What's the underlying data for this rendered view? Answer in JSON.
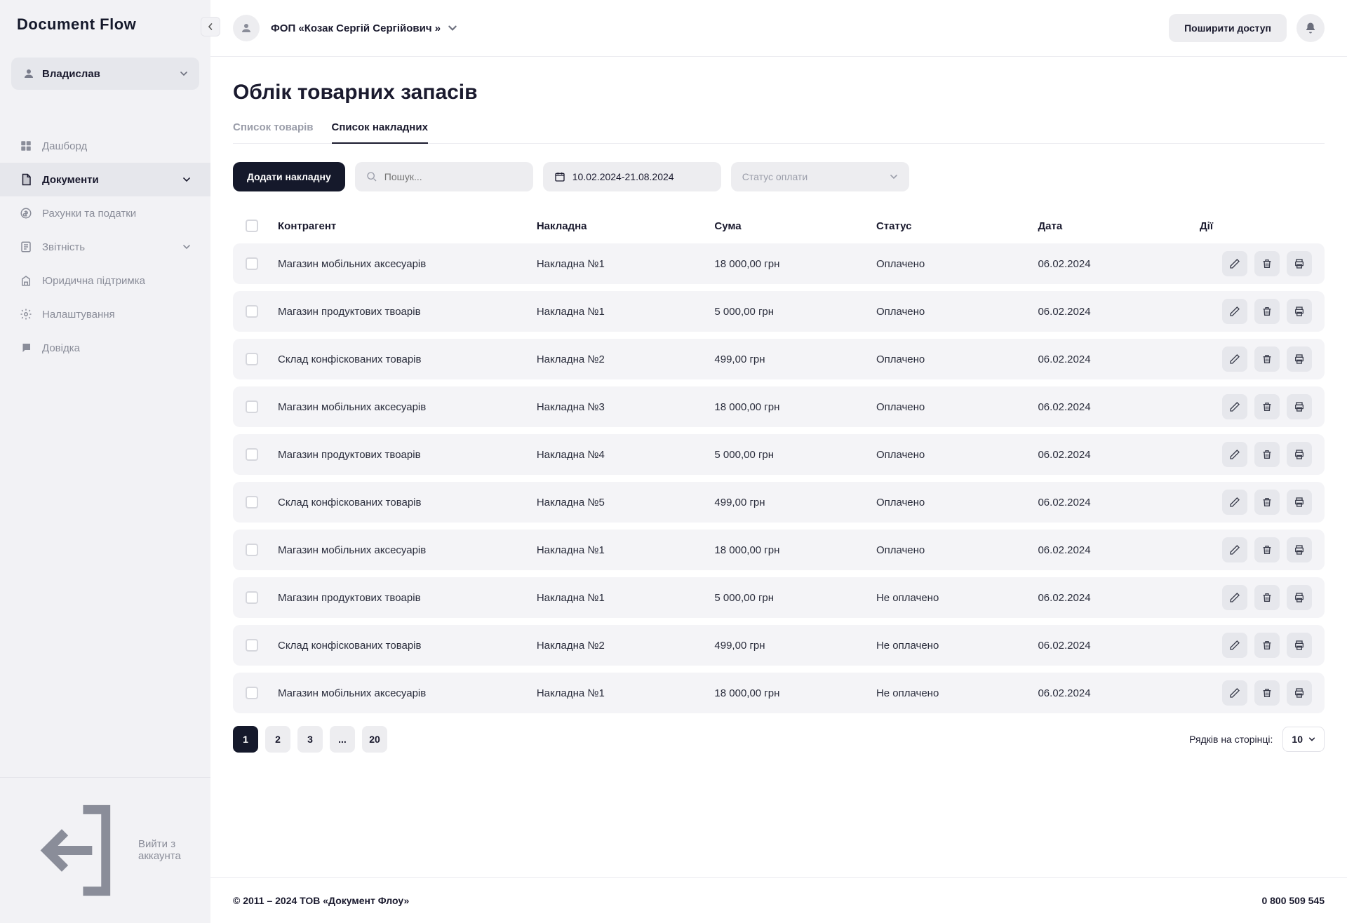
{
  "brand": "Document Flow",
  "user": {
    "name": "Владислав"
  },
  "sidebar": {
    "items": [
      {
        "label": "Дашборд",
        "icon": "dashboard",
        "expandable": false
      },
      {
        "label": "Документи",
        "icon": "documents",
        "expandable": true,
        "active": true
      },
      {
        "label": "Рахунки та податки",
        "icon": "accounts",
        "expandable": false
      },
      {
        "label": "Звітність",
        "icon": "reports",
        "expandable": true
      },
      {
        "label": "Юридична підтримка",
        "icon": "legal",
        "expandable": false
      },
      {
        "label": "Налаштування",
        "icon": "settings",
        "expandable": false
      },
      {
        "label": "Довідка",
        "icon": "help",
        "expandable": false
      }
    ],
    "logout_label": "Вийти з аккаунта"
  },
  "topbar": {
    "company": "ФОП «Козак Сергій Сергійович »",
    "share_label": "Поширити доступ"
  },
  "page": {
    "title": "Облік товарних запасів",
    "tabs": [
      {
        "label": "Список товарів",
        "active": false
      },
      {
        "label": "Список накладних",
        "active": true
      }
    ]
  },
  "toolbar": {
    "add_label": "Додати накладну",
    "search_placeholder": "Пошук...",
    "date_range": "10.02.2024-21.08.2024",
    "status_placeholder": "Статус оплати"
  },
  "table": {
    "headers": {
      "counterparty": "Контрагент",
      "invoice": "Накладна",
      "amount": "Сума",
      "status": "Статус",
      "date": "Дата",
      "actions": "Дії"
    },
    "rows": [
      {
        "counterparty": "Магазин мобільних аксесуарів",
        "invoice": "Накладна №1",
        "amount": "18 000,00 грн",
        "status": "Оплачено",
        "date": "06.02.2024"
      },
      {
        "counterparty": "Магазин продуктових твоарів",
        "invoice": "Накладна №1",
        "amount": "5 000,00 грн",
        "status": "Оплачено",
        "date": "06.02.2024"
      },
      {
        "counterparty": "Склад конфіскованих товарів",
        "invoice": "Накладна №2",
        "amount": "499,00 грн",
        "status": "Оплачено",
        "date": "06.02.2024"
      },
      {
        "counterparty": "Магазин мобільних аксесуарів",
        "invoice": "Накладна №3",
        "amount": "18 000,00 грн",
        "status": "Оплачено",
        "date": "06.02.2024"
      },
      {
        "counterparty": "Магазин продуктових твоарів",
        "invoice": "Накладна №4",
        "amount": "5 000,00 грн",
        "status": "Оплачено",
        "date": "06.02.2024"
      },
      {
        "counterparty": "Склад конфіскованих товарів",
        "invoice": "Накладна №5",
        "amount": "499,00 грн",
        "status": "Оплачено",
        "date": "06.02.2024"
      },
      {
        "counterparty": "Магазин мобільних аксесуарів",
        "invoice": "Накладна №1",
        "amount": "18 000,00 грн",
        "status": "Оплачено",
        "date": "06.02.2024"
      },
      {
        "counterparty": "Магазин продуктових твоарів",
        "invoice": "Накладна №1",
        "amount": "5 000,00 грн",
        "status": "Не оплачено",
        "date": "06.02.2024"
      },
      {
        "counterparty": "Склад конфіскованих товарів",
        "invoice": "Накладна №2",
        "amount": "499,00 грн",
        "status": "Не оплачено",
        "date": "06.02.2024"
      },
      {
        "counterparty": "Магазин мобільних аксесуарів",
        "invoice": "Накладна №1",
        "amount": "18 000,00 грн",
        "status": "Не оплачено",
        "date": "06.02.2024"
      }
    ]
  },
  "pagination": {
    "pages": [
      "1",
      "2",
      "3",
      "...",
      "20"
    ],
    "active_index": 0,
    "rows_per_page_label": "Рядків на сторінці:",
    "rows_per_page_value": "10"
  },
  "footer": {
    "copyright": "© 2011 – 2024 ТОВ «Документ Флоу»",
    "phone": "0 800 509 545"
  }
}
